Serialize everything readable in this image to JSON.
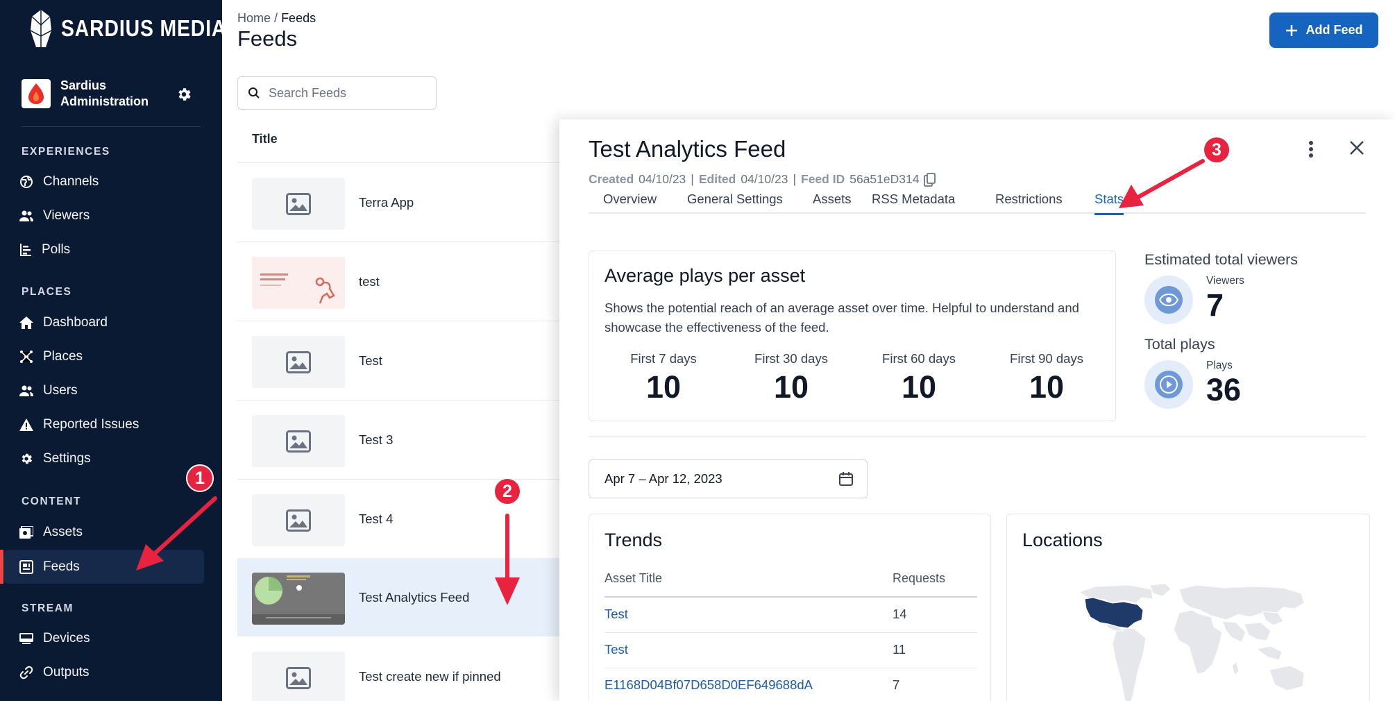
{
  "brand": {
    "name": "SARDIUS MEDIA"
  },
  "org": {
    "name": "Sardius Administration"
  },
  "sidebar": {
    "sections": [
      {
        "label": "EXPERIENCES",
        "items": [
          {
            "label": "Channels",
            "icon": "globe-icon"
          },
          {
            "label": "Viewers",
            "icon": "people-icon"
          },
          {
            "label": "Polls",
            "icon": "poll-icon"
          }
        ]
      },
      {
        "label": "PLACES",
        "items": [
          {
            "label": "Dashboard",
            "icon": "home-icon"
          },
          {
            "label": "Places",
            "icon": "hub-icon"
          },
          {
            "label": "Users",
            "icon": "people-icon"
          },
          {
            "label": "Reported Issues",
            "icon": "warning-icon"
          },
          {
            "label": "Settings",
            "icon": "gear-icon"
          }
        ]
      },
      {
        "label": "CONTENT",
        "items": [
          {
            "label": "Assets",
            "icon": "assets-icon"
          },
          {
            "label": "Feeds",
            "icon": "feed-icon",
            "active": true
          }
        ]
      },
      {
        "label": "STREAM",
        "items": [
          {
            "label": "Devices",
            "icon": "device-icon"
          },
          {
            "label": "Outputs",
            "icon": "link-icon"
          }
        ]
      }
    ]
  },
  "breadcrumb": {
    "home": "Home",
    "separator": "/",
    "current": "Feeds"
  },
  "page": {
    "title": "Feeds"
  },
  "header": {
    "add_label": "Add Feed"
  },
  "search": {
    "placeholder": "Search Feeds"
  },
  "list": {
    "column_title": "Title",
    "rows": [
      {
        "title": "Terra App",
        "thumb": "placeholder"
      },
      {
        "title": "test",
        "thumb": "working-on-video"
      },
      {
        "title": "Test",
        "thumb": "placeholder"
      },
      {
        "title": "Test 3",
        "thumb": "placeholder"
      },
      {
        "title": "Test 4",
        "thumb": "placeholder"
      },
      {
        "title": "Test Analytics Feed",
        "thumb": "video-frame",
        "selected": true
      },
      {
        "title": "Test create new if pinned",
        "thumb": "placeholder"
      }
    ]
  },
  "drawer": {
    "title": "Test Analytics Feed",
    "meta": {
      "created_label": "Created",
      "created": "04/10/23",
      "edited_label": "Edited",
      "edited": "04/10/23",
      "feed_id_label": "Feed ID",
      "feed_id": "56a51eD314",
      "separator": "|"
    },
    "tabs": [
      {
        "label": "Overview"
      },
      {
        "label": "General Settings"
      },
      {
        "label": "Assets"
      },
      {
        "label": "RSS Metadata"
      },
      {
        "label": "Restrictions"
      },
      {
        "label": "Stats",
        "active": true
      }
    ],
    "avg_plays": {
      "title": "Average plays per asset",
      "description": "Shows the potential reach of an average asset over time. Helpful to understand and showcase the effectiveness of the feed.",
      "stats": [
        {
          "label": "First 7 days",
          "value": "10"
        },
        {
          "label": "First 30 days",
          "value": "10"
        },
        {
          "label": "First 60 days",
          "value": "10"
        },
        {
          "label": "First 90 days",
          "value": "10"
        }
      ]
    },
    "viewers": {
      "heading": "Estimated total viewers",
      "label": "Viewers",
      "value": "7"
    },
    "plays": {
      "heading": "Total plays",
      "label": "Plays",
      "value": "36"
    },
    "date_range": "Apr 7 – Apr 12, 2023",
    "trends": {
      "title": "Trends",
      "col_asset": "Asset Title",
      "col_requests": "Requests",
      "rows": [
        {
          "asset": "Test",
          "requests": "14"
        },
        {
          "asset": "Test",
          "requests": "11"
        },
        {
          "asset": "E1168D04Bf07D658D0EF649688dA",
          "requests": "7"
        }
      ]
    },
    "locations": {
      "title": "Locations",
      "highlighted": "United States"
    }
  },
  "annotations": [
    {
      "label": "1"
    },
    {
      "label": "2"
    },
    {
      "label": "3"
    }
  ],
  "colors": {
    "sidebar_bg": "#0b1a33",
    "accent": "#1565c0",
    "active_indicator": "#ef4444",
    "marker": "#e8233f",
    "map_highlight": "#1f3a68"
  }
}
